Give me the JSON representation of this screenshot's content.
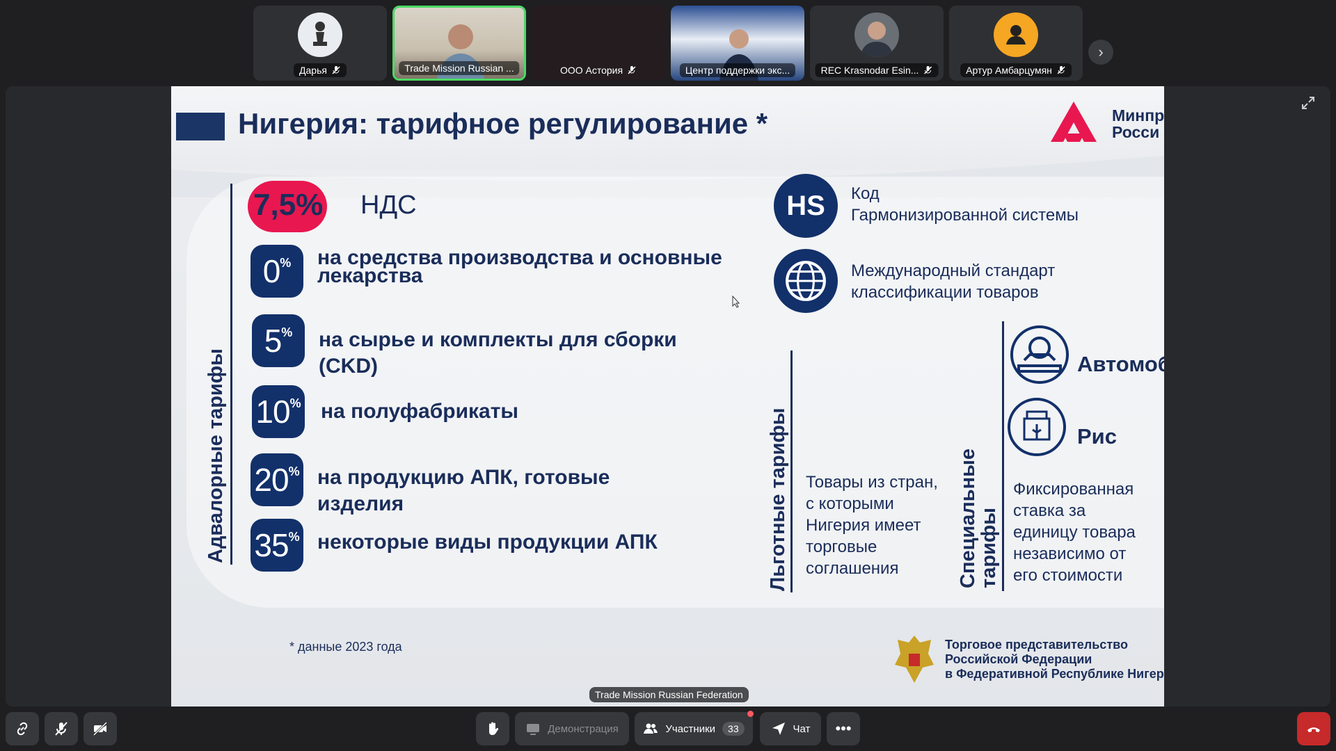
{
  "participants": [
    {
      "name": "Дарья",
      "muted": true,
      "avatar_icon": "chess-pawn-icon"
    },
    {
      "name": "Trade Mission Russian ...",
      "muted": false,
      "active": true,
      "avatar_icon": "camera-video"
    },
    {
      "name": "ООО Астория",
      "muted": true,
      "avatar_icon": "camera-off"
    },
    {
      "name": "Центр поддержки экс...",
      "muted": false,
      "avatar_icon": "camera-video"
    },
    {
      "name": "REC Krasnodar Esin...",
      "muted": true,
      "avatar_icon": "photo-avatar"
    },
    {
      "name": "Артур Амбарцумян",
      "muted": true,
      "avatar_icon": "person-icon"
    }
  ],
  "slide": {
    "title": "Нигерия: тарифное регулирование *",
    "logo_text_line1": "Минпр",
    "logo_text_line2": "Росси",
    "advalorem_label": "Адвалорные тарифы",
    "vat": {
      "value": "7,5%",
      "label": "НДС"
    },
    "tariffs": [
      {
        "num": "0",
        "sym": "%",
        "text": "на средства производства и основные лекарства"
      },
      {
        "num": "5",
        "sym": "%",
        "text": "на сырье и комплекты для сборки (CKD)"
      },
      {
        "num": "10",
        "sym": "%",
        "text": "на полуфабрикаты"
      },
      {
        "num": "20",
        "sym": "%",
        "text": "на продукцию АПК, готовые изделия"
      },
      {
        "num": "35",
        "sym": "%",
        "text": "некоторые виды продукции АПК"
      }
    ],
    "hs": {
      "icon_text": "HS",
      "line1": "Код",
      "line2": "Гармонизированной системы"
    },
    "intl": {
      "line1": "Международный стандарт",
      "line2": "классификации товаров"
    },
    "preferential_label": "Льготные тарифы",
    "preferential_text": [
      "Товары из стран,",
      "с которыми",
      "Нигерия имеет",
      "торговые",
      "соглашения"
    ],
    "special_label_line1": "Специальные",
    "special_label_line2": "тарифы",
    "special_items": [
      "Автомоб",
      "Рис"
    ],
    "special_text": [
      "Фиксированная",
      "ставка за",
      "единицу товара",
      "независимо от",
      "его стоимости"
    ],
    "footnote": "* данные 2023 года",
    "org": [
      "Торговое представительство",
      "Российской Федерации",
      "в Федеративной Республике Нигер"
    ],
    "colors": {
      "navy": "#12306a",
      "accent_red": "#e8174f",
      "text": "#1a2d5a"
    }
  },
  "presenter_tag": "Trade Mission Russian Federation",
  "toolbar": {
    "screen_share_label": "Демонстрация",
    "participants_label": "Участники",
    "participants_count": "33",
    "chat_label": "Чат"
  }
}
